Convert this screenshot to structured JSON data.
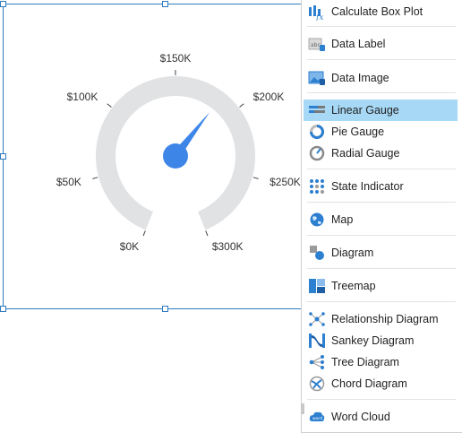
{
  "gauge": {
    "labels": [
      "$0K",
      "$50K",
      "$100K",
      "$150K",
      "$200K",
      "$250K",
      "$300K"
    ],
    "value_fraction": 0.62,
    "colors": {
      "track": "#e1e2e4",
      "needle": "#3d86e8",
      "text": "#333333"
    }
  },
  "menu": {
    "items": [
      {
        "label": "Calculate Box Plot",
        "icon": "box-plot-icon"
      },
      {
        "label": "Data Label",
        "icon": "data-label-icon"
      },
      {
        "label": "Data Image",
        "icon": "data-image-icon"
      },
      {
        "label": "Linear Gauge",
        "icon": "linear-gauge-icon",
        "selected": true
      },
      {
        "label": "Pie Gauge",
        "icon": "pie-gauge-icon"
      },
      {
        "label": "Radial Gauge",
        "icon": "radial-gauge-icon"
      },
      {
        "label": "State Indicator",
        "icon": "state-indicator-icon"
      },
      {
        "label": "Map",
        "icon": "map-icon"
      },
      {
        "label": "Diagram",
        "icon": "diagram-icon"
      },
      {
        "label": "Treemap",
        "icon": "treemap-icon"
      },
      {
        "label": "Relationship Diagram",
        "icon": "relationship-diagram-icon"
      },
      {
        "label": "Sankey Diagram",
        "icon": "sankey-diagram-icon"
      },
      {
        "label": "Tree Diagram",
        "icon": "tree-diagram-icon"
      },
      {
        "label": "Chord Diagram",
        "icon": "chord-diagram-icon"
      },
      {
        "label": "Word Cloud",
        "icon": "word-cloud-icon"
      }
    ],
    "colors": {
      "highlight": "#a7d8f5",
      "icon_blue": "#2d7fd0"
    }
  }
}
